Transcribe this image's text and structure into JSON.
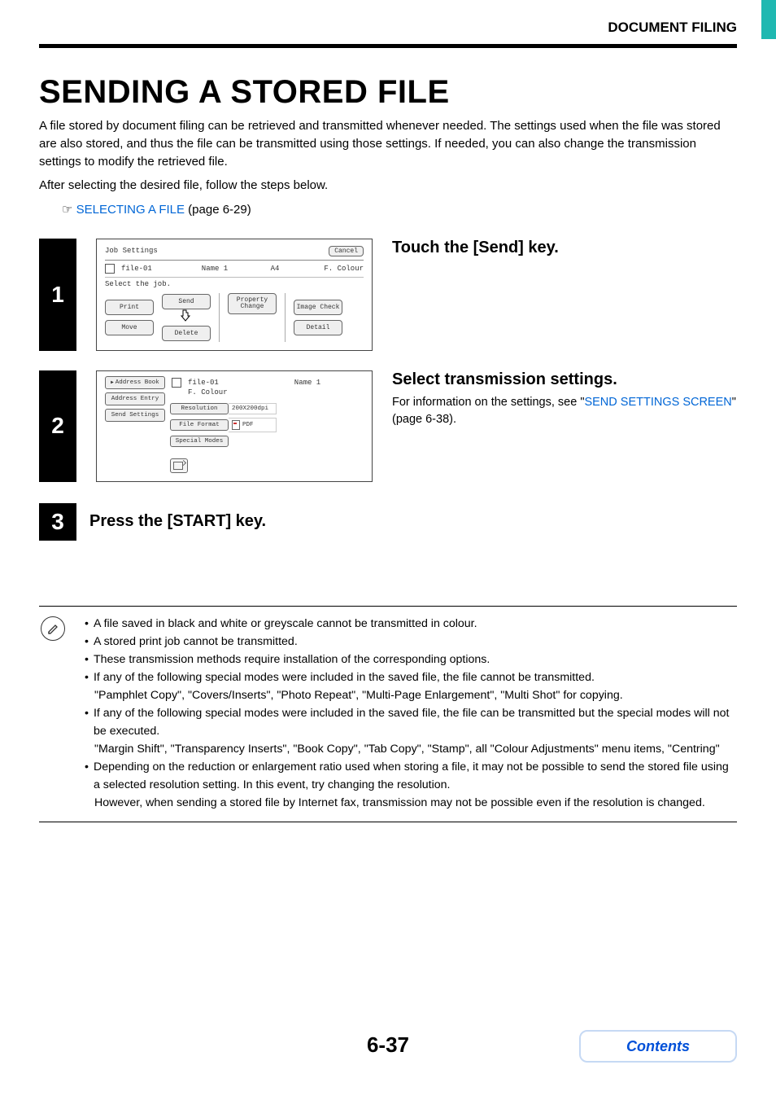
{
  "header": {
    "section": "DOCUMENT FILING"
  },
  "title": "SENDING A STORED FILE",
  "intro": {
    "p1": "A file stored by document filing can be retrieved and transmitted whenever needed. The settings used when the file was stored are also stored, and thus the file can be transmitted using those settings. If needed, you can also change the transmission settings to modify the retrieved file.",
    "p2": "After selecting the desired file, follow the steps below.",
    "link_pre": "☞ ",
    "link": "SELECTING A FILE",
    "link_post": " (page 6-29)"
  },
  "step1": {
    "num": "1",
    "heading": "Touch the [Send] key.",
    "screen": {
      "title": "Job Settings",
      "cancel": "Cancel",
      "file": "file-01",
      "name": "Name 1",
      "size": "A4",
      "colour": "F. Colour",
      "prompt": "Select the job.",
      "btn_print": "Print",
      "btn_move": "Move",
      "btn_send": "Send",
      "btn_del": "Delete",
      "btn_prop": "Property Change",
      "btn_img": "Image Check",
      "btn_det": "Detail"
    }
  },
  "step2": {
    "num": "2",
    "heading": "Select transmission settings.",
    "body_pre": "For information on the settings, see \"",
    "body_link": "SEND SETTINGS SCREEN",
    "body_post": "\" (page 6-38).",
    "screen": {
      "tab_ab": "Address Book",
      "tab_ae": "Address Entry",
      "tab_ss": "Send Settings",
      "file": "file-01",
      "name": "Name 1",
      "colour": "F. Colour",
      "btn_res": "Resolution",
      "val_res": "200X200dpi",
      "btn_ff": "File Format",
      "val_ff": "PDF",
      "btn_sm": "Special Modes"
    }
  },
  "step3": {
    "num": "3",
    "heading": "Press the [START] key."
  },
  "notes": {
    "b1": "A file saved in black and white or greyscale cannot be transmitted in colour.",
    "b2": "A stored print job cannot be transmitted.",
    "b3": "These transmission methods require installation of the corresponding options.",
    "b4": "If any of the following special modes were included in the saved file, the file cannot be transmitted.",
    "b4c": "\"Pamphlet Copy\", \"Covers/Inserts\", \"Photo Repeat\", \"Multi-Page Enlargement\", \"Multi Shot\" for copying.",
    "b5": "If any of the following special modes were included in the saved file, the file can be transmitted but the special modes will not be executed.",
    "b5c": "\"Margin Shift\", \"Transparency Inserts\", \"Book Copy\", \"Tab Copy\", \"Stamp\", all \"Colour Adjustments\" menu items, \"Centring\"",
    "b6": "Depending on the reduction or enlargement ratio used when storing a file, it may not be possible to send the stored file using a selected resolution setting. In this event, try changing the resolution.",
    "b6c": "However, when sending a stored file by Internet fax, transmission may not be possible even if the resolution is changed."
  },
  "footer": {
    "page": "6-37",
    "contents": "Contents"
  }
}
